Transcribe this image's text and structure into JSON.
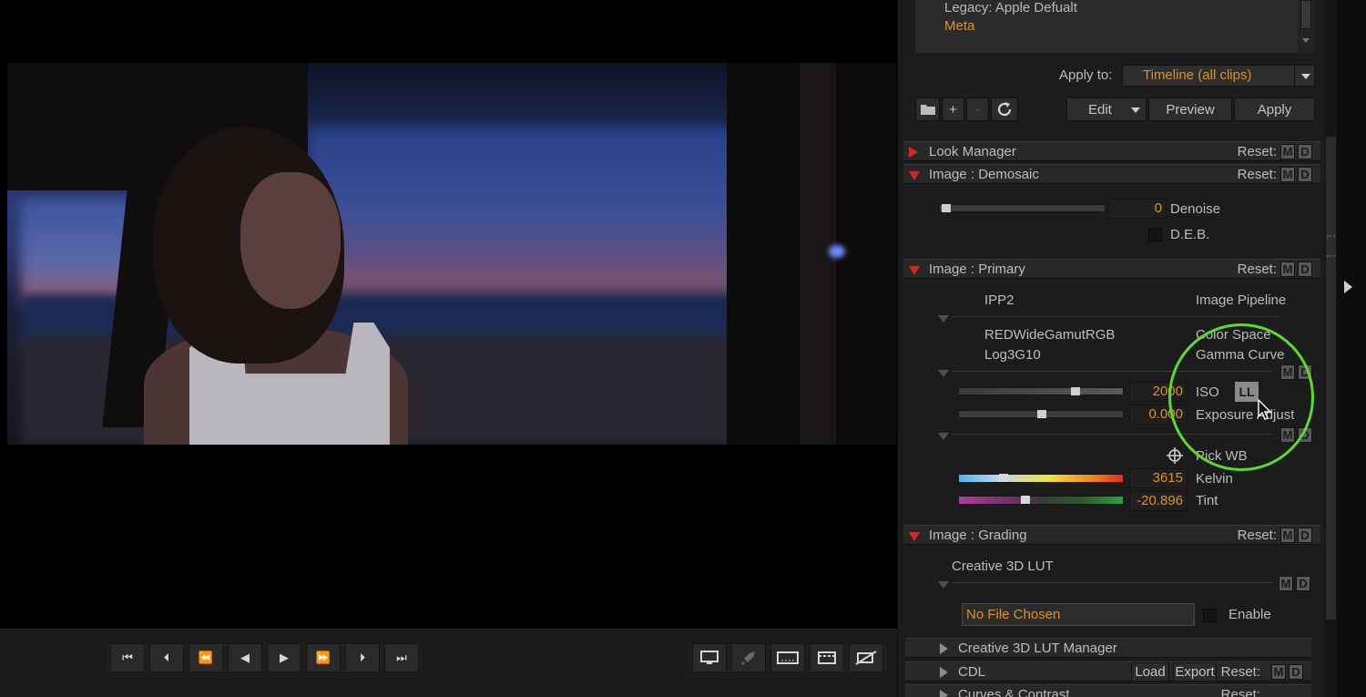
{
  "viewer": {
    "transport_buttons": [
      {
        "icon": "skip-to-start-icon",
        "glyph": "⏮"
      },
      {
        "icon": "previous-frame-icon",
        "glyph": "⏴"
      },
      {
        "icon": "rewind-icon",
        "glyph": "⏪"
      },
      {
        "icon": "play-reverse-icon",
        "glyph": "◀"
      },
      {
        "icon": "play-icon",
        "glyph": "▶"
      },
      {
        "icon": "fast-forward-icon",
        "glyph": "⏩"
      },
      {
        "icon": "next-frame-icon",
        "glyph": "⏵"
      },
      {
        "icon": "skip-to-end-icon",
        "glyph": "⏭"
      }
    ],
    "view_buttons": [
      {
        "icon": "monitor-icon"
      },
      {
        "icon": "rocket-icon"
      },
      {
        "icon": "safe-area-icon"
      },
      {
        "icon": "clapperboard-icon"
      },
      {
        "icon": "overlay-off-icon"
      }
    ]
  },
  "presets": {
    "items": [
      "Legacy: Apple Defualt",
      "Meta"
    ],
    "selected": "Meta",
    "apply_to_label": "Apply to:",
    "apply_to_value": "Timeline (all clips)",
    "tools": {
      "folder": "folder-icon",
      "plus": "+",
      "minus": "-",
      "refresh": "refresh-icon"
    },
    "edit_label": "Edit",
    "preview_label": "Preview",
    "apply_label": "Apply"
  },
  "sections": {
    "look_manager": {
      "title": "Look Manager",
      "reset": "Reset:",
      "m": "M",
      "d": "D"
    },
    "demosaic": {
      "title": "Image : Demosaic",
      "reset": "Reset:",
      "m": "M",
      "d": "D",
      "denoise_value": "0",
      "denoise_label": "Denoise",
      "denoise_level": 0.0,
      "deb_label": "D.E.B.",
      "deb_checked": false
    },
    "primary": {
      "title": "Image : Primary",
      "reset": "Reset:",
      "m": "M",
      "d": "D",
      "pipeline_value": "IPP2",
      "pipeline_label": "Image Pipeline",
      "color_space_value": "REDWideGamutRGB",
      "color_space_label": "Color Space",
      "gamma_value": "Log3G10",
      "gamma_label": "Gamma Curve",
      "iso_value": "2000",
      "iso_label": "ISO",
      "ll_label": "LL",
      "exposure_value": "0.000",
      "exposure_label": "Exposure Adjust",
      "pick_wb_label": "Pick WB",
      "kelvin_value": "3615",
      "kelvin_label": "Kelvin",
      "tint_value": "-20.896",
      "tint_label": "Tint"
    },
    "grading": {
      "title": "Image : Grading",
      "reset": "Reset:",
      "m": "M",
      "d": "D",
      "lut_label": "Creative 3D LUT",
      "file_value": "No File Chosen",
      "enable_label": "Enable",
      "enable_checked": false
    },
    "lut_manager": {
      "title": "Creative 3D LUT Manager"
    },
    "cdl": {
      "title": "CDL",
      "load": "Load",
      "export": "Export",
      "reset": "Reset:",
      "m": "M",
      "d": "D"
    },
    "curves": {
      "title": "Curves & Contrast",
      "reset": "Reset:"
    }
  },
  "colors": {
    "accent": "#e0902a",
    "section_triangle": "#d12a1e",
    "highlight_ring": "#5cdb2e"
  }
}
